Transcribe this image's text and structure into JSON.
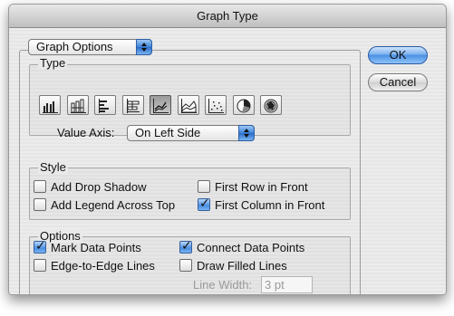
{
  "window": {
    "title": "Graph Type"
  },
  "section_select": {
    "value": "Graph Options"
  },
  "type_group": {
    "label": "Type",
    "graph_types": [
      {
        "name": "grouped-column",
        "selected": false
      },
      {
        "name": "stacked-column",
        "selected": false
      },
      {
        "name": "bar",
        "selected": false
      },
      {
        "name": "stacked-bar",
        "selected": false
      },
      {
        "name": "line",
        "selected": true
      },
      {
        "name": "area",
        "selected": false
      },
      {
        "name": "scatter",
        "selected": false
      },
      {
        "name": "pie",
        "selected": false
      },
      {
        "name": "radar",
        "selected": false
      }
    ],
    "value_axis_label": "Value Axis:",
    "value_axis_value": "On Left Side"
  },
  "style_group": {
    "label": "Style",
    "add_drop_shadow": {
      "label": "Add Drop Shadow",
      "checked": false
    },
    "add_legend_across_top": {
      "label": "Add Legend Across Top",
      "checked": false
    },
    "first_row_in_front": {
      "label": "First Row in Front",
      "checked": false
    },
    "first_column_in_front": {
      "label": "First Column in Front",
      "checked": true
    }
  },
  "options_group": {
    "label": "Options",
    "mark_data_points": {
      "label": "Mark Data Points",
      "checked": true
    },
    "edge_to_edge_lines": {
      "label": "Edge-to-Edge Lines",
      "checked": false
    },
    "connect_data_points": {
      "label": "Connect Data Points",
      "checked": true
    },
    "draw_filled_lines": {
      "label": "Draw Filled Lines",
      "checked": false
    },
    "line_width_label": "Line Width:",
    "line_width_value": "3 pt"
  },
  "buttons": {
    "ok": "OK",
    "cancel": "Cancel"
  },
  "colors": {
    "accent": "#3b82d8",
    "dialog_bg": "#ececec"
  }
}
